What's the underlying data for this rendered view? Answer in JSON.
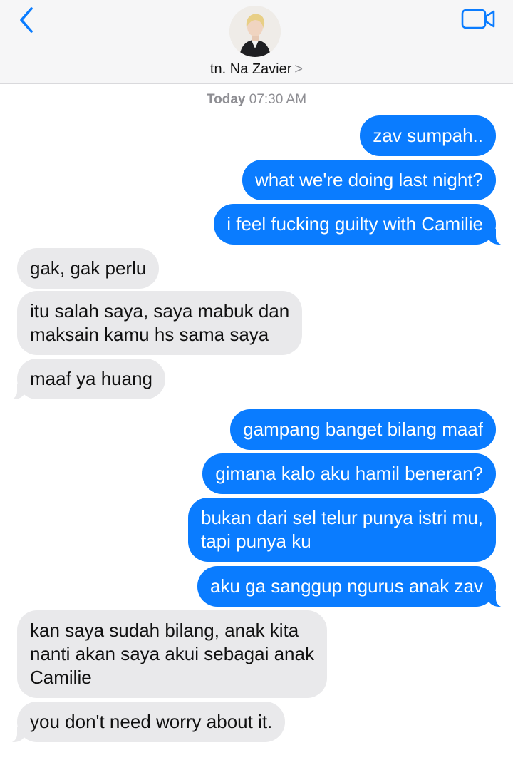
{
  "header": {
    "contact_name": "tn. Na Zavier",
    "contact_chevron": ">",
    "back_icon": "chevron-left-icon",
    "video_icon": "video-camera-icon",
    "accent_color": "#0a7cff"
  },
  "thread": {
    "timestamp_day": "Today",
    "timestamp_time": "07:30 AM",
    "messages": [
      {
        "from": "me",
        "text": "zav sumpah.."
      },
      {
        "from": "me",
        "text": "what we're doing last night?"
      },
      {
        "from": "me",
        "text": "i feel fucking guilty with Camilie"
      },
      {
        "from": "them",
        "text": "gak, gak perlu"
      },
      {
        "from": "them",
        "text": "itu salah saya, saya mabuk dan\nmaksain kamu hs sama saya"
      },
      {
        "from": "them",
        "text": "maaf ya huang"
      },
      {
        "from": "me",
        "text": "gampang banget bilang maaf"
      },
      {
        "from": "me",
        "text": "gimana kalo aku hamil beneran?"
      },
      {
        "from": "me",
        "text": "bukan dari sel telur punya istri mu,\ntapi punya ku"
      },
      {
        "from": "me",
        "text": "aku ga sanggup ngurus anak zav"
      },
      {
        "from": "them",
        "text": "kan saya sudah bilang, anak kita\nnanti akan saya akui sebagai anak\nCamilie"
      },
      {
        "from": "them",
        "text": "you don't need worry about it."
      }
    ]
  }
}
